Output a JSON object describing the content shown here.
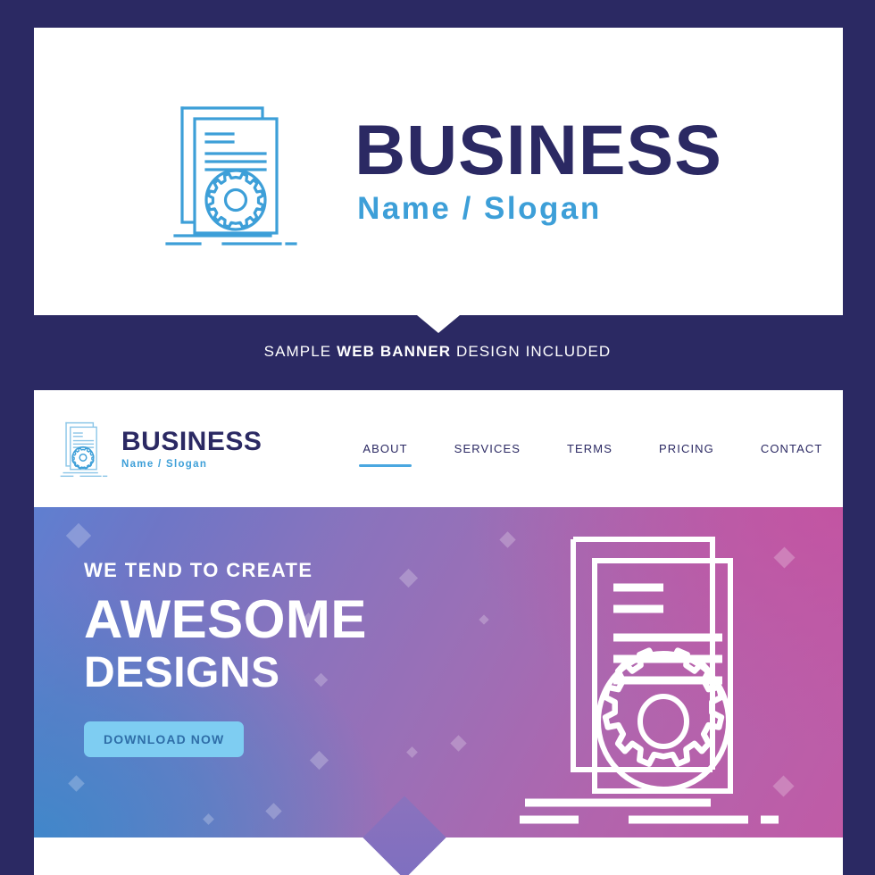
{
  "page": {
    "background_color": "#2b2963",
    "card_color": "#ffffff"
  },
  "logo_card": {
    "icon_name": "document-gear-icon",
    "title": "BUSINESS",
    "subtitle": "Name / Slogan",
    "title_color": "#2b2963",
    "subtitle_color": "#3d9fd8"
  },
  "caption": {
    "prefix": "SAMPLE ",
    "bold": "WEB BANNER",
    "suffix": " DESIGN INCLUDED",
    "color": "#ffffff"
  },
  "web_banner": {
    "navbar": {
      "logo_icon_name": "document-gear-icon",
      "brand_title": "BUSINESS",
      "brand_subtitle": "Name / Slogan",
      "menu": [
        {
          "label": "ABOUT",
          "active": true
        },
        {
          "label": "SERVICES",
          "active": false
        },
        {
          "label": "TERMS",
          "active": false
        },
        {
          "label": "PRICING",
          "active": false
        },
        {
          "label": "CONTACT",
          "active": false
        }
      ],
      "active_underline_color": "#4aa7e0"
    },
    "hero": {
      "kicker": "WE TEND TO CREATE",
      "headline_1": "AWESOME",
      "headline_2": "DESIGNS",
      "cta_label": "DOWNLOAD NOW",
      "cta_background": "#7ecdf2",
      "cta_text_color": "#2f6ea8",
      "art_icon_name": "document-gear-icon",
      "gradient_from": "#5f7fd0",
      "gradient_mid": "#9c6fb6",
      "gradient_to": "#c05ba6",
      "decor_icon_name": "diamond-decoration"
    }
  }
}
